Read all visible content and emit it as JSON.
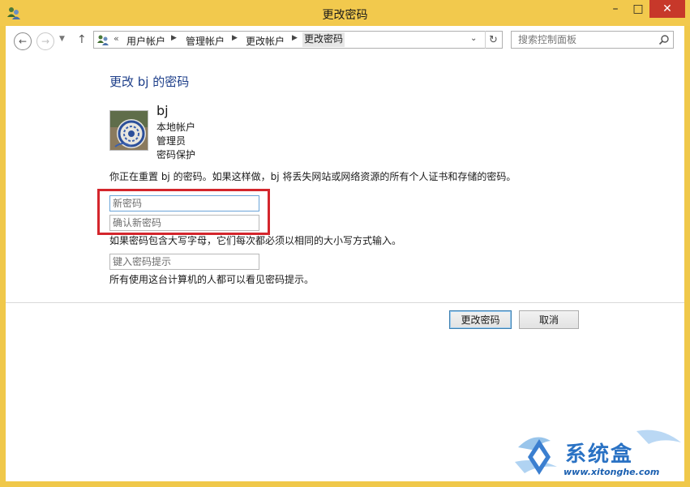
{
  "window": {
    "title": "更改密码",
    "buttons": {
      "minimize": "–",
      "maximize": "□",
      "close": "✕"
    }
  },
  "nav": {
    "back_icon": "back-arrow-icon",
    "forward_icon": "forward-arrow-icon",
    "up_icon": "up-arrow-icon",
    "breadcrumb_prefix": "«",
    "breadcrumbs": [
      "用户帐户",
      "管理帐户",
      "更改帐户",
      "更改密码"
    ],
    "search_placeholder": "搜索控制面板"
  },
  "page": {
    "heading": "更改 bj 的密码",
    "user": {
      "name": "bj",
      "account_type": "本地帐户",
      "role": "管理员",
      "protection": "密码保护"
    },
    "warning": "你正在重置 bj 的密码。如果这样做，bj 将丢失网站或网络资源的所有个人证书和存储的密码。",
    "new_password_placeholder": "新密码",
    "confirm_password_placeholder": "确认新密码",
    "case_note": "如果密码包含大写字母，它们每次都必须以相同的大小写方式输入。",
    "hint_placeholder": "键入密码提示",
    "hint_note": "所有使用这台计算机的人都可以看见密码提示。"
  },
  "actions": {
    "change_password": "更改密码",
    "cancel": "取消"
  },
  "watermark": {
    "text": "系统盒",
    "url": "www.xitonghe.com"
  },
  "colors": {
    "titlebar": "#f2c94d",
    "heading": "#1e3f8a",
    "highlight": "#d4262c",
    "close_button": "#c7382a"
  }
}
